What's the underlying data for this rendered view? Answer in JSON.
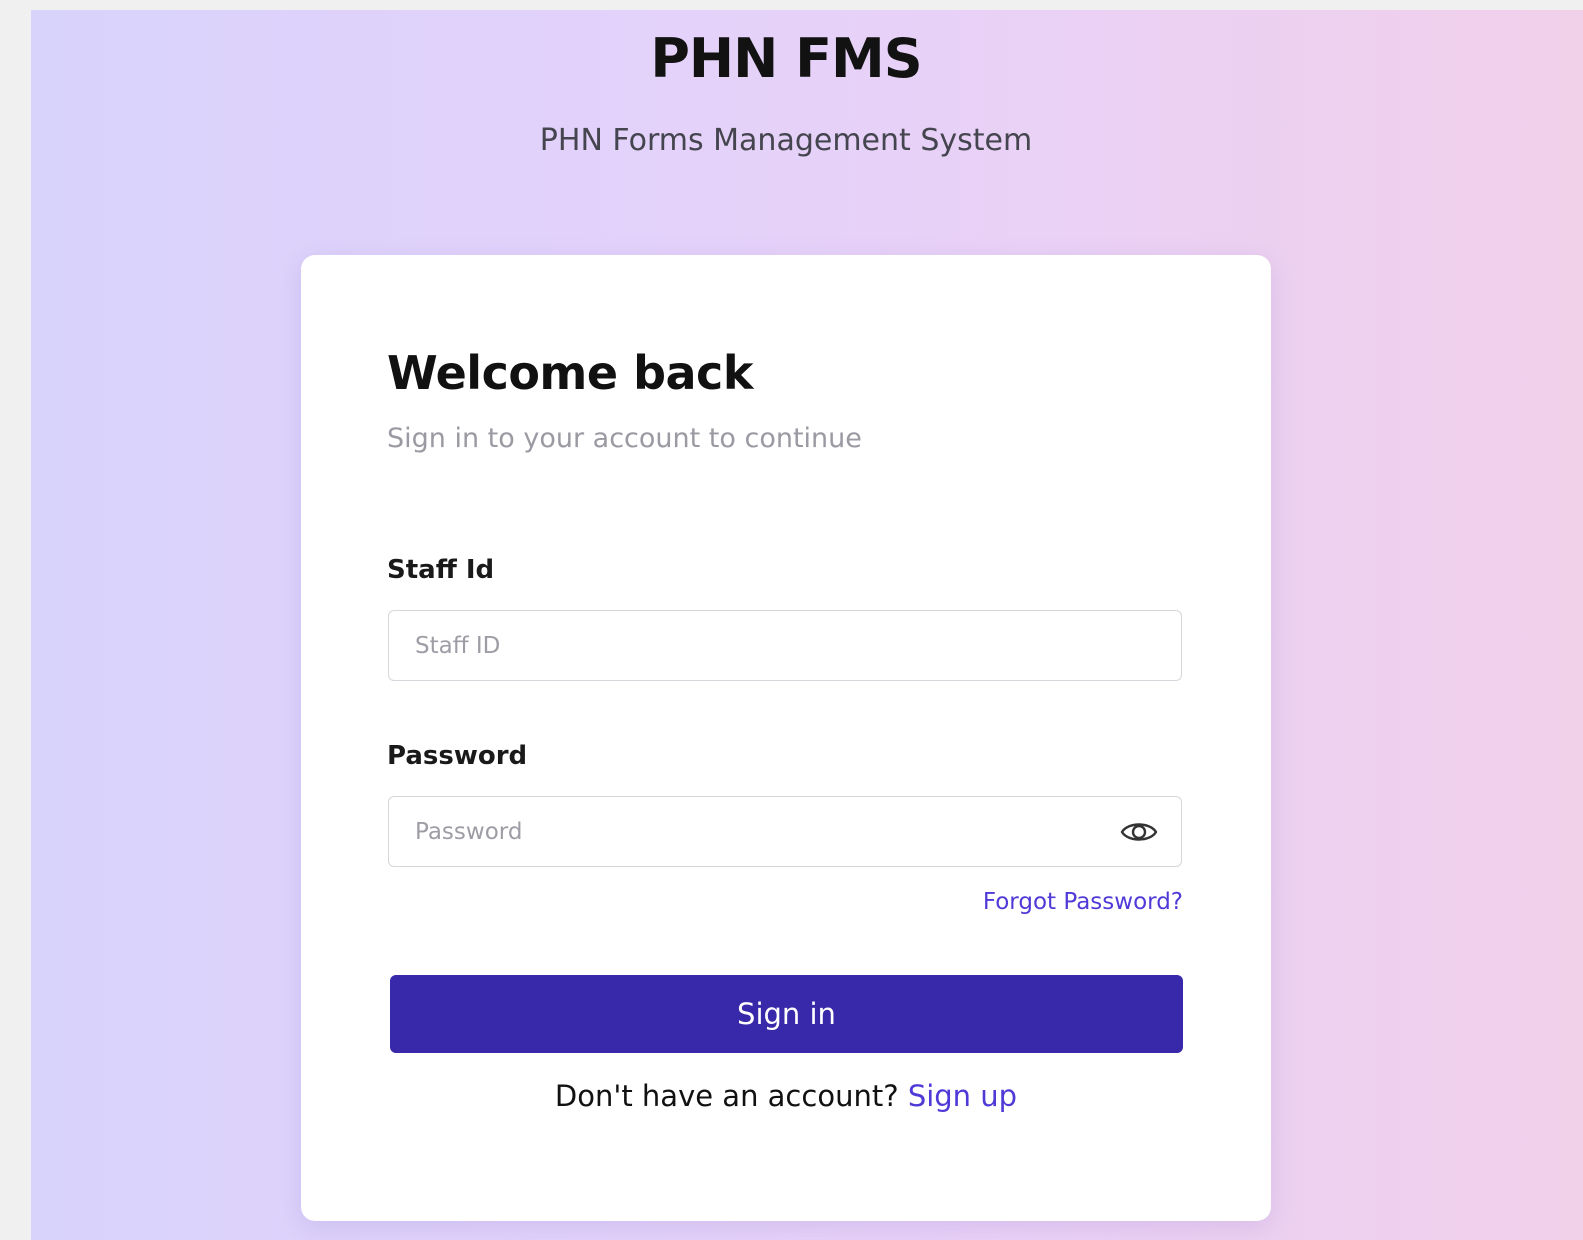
{
  "header": {
    "title": "PHN FMS",
    "subtitle": "PHN Forms Management System"
  },
  "login_card": {
    "heading": "Welcome back",
    "subheading": "Sign in to your account to continue",
    "staff_id": {
      "label": "Staff Id",
      "placeholder": "Staff ID",
      "value": ""
    },
    "password": {
      "label": "Password",
      "placeholder": "Password",
      "value": "",
      "toggle_icon": "eye-icon"
    },
    "forgot_password_label": "Forgot Password?",
    "signin_label": "Sign in",
    "signup_prompt": "Don't have an account?",
    "signup_link": "Sign up"
  },
  "colors": {
    "primary_button": "#3828aa",
    "link": "#4f3ad8",
    "background_start": "#d8d3fb",
    "background_end": "#f1d0ea"
  }
}
